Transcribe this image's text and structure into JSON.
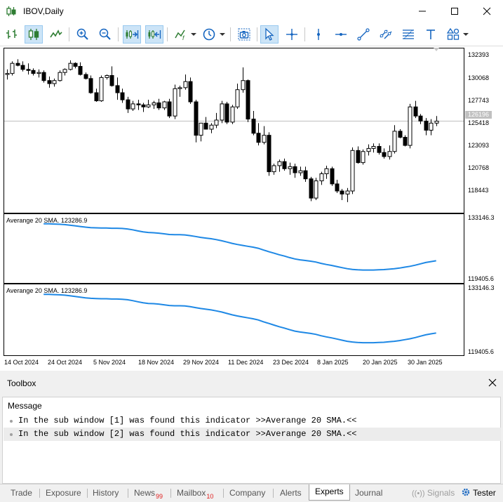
{
  "window": {
    "title": "IBOV,Daily",
    "controls": {
      "minimize": "minimize",
      "maximize": "maximize",
      "close": "close"
    }
  },
  "toolbar": {
    "items": [
      "bar-chart-icon",
      "candlestick-icon",
      "line-chart-icon",
      "zoom-in-icon",
      "zoom-out-icon",
      "autoscroll-icon",
      "chart-shift-icon",
      "indicators-icon",
      "periods-icon",
      "screenshot-icon",
      "cursor-icon",
      "crosshair-icon",
      "vertical-line-icon",
      "horizontal-line-icon",
      "trendline-icon",
      "channel-icon",
      "fibonacci-icon",
      "text-icon",
      "shapes-icon"
    ]
  },
  "chart": {
    "symbol": "IBOV",
    "timeframe": "Daily",
    "bid_price": "126196",
    "price_axis": [
      "132393",
      "130068",
      "127743",
      "125418",
      "123093",
      "120768",
      "118443"
    ],
    "date_axis": [
      "14 Oct 2024",
      "24 Oct 2024",
      "5 Nov 2024",
      "18 Nov 2024",
      "29 Nov 2024",
      "11 Dec 2024",
      "23 Dec 2024",
      "8 Jan 2025",
      "20 Jan 2025",
      "30 Jan 2025"
    ],
    "sub1": {
      "label": "Averange 20 SMA. 123286.9",
      "max": "133146.3",
      "min": "119405.6"
    },
    "sub2": {
      "label": "Averange 20 SMA. 123286.9",
      "max": "133146.3",
      "min": "119405.6"
    },
    "colors": {
      "sma_line": "#1e88e5",
      "bull": "#ffffff",
      "bear": "#000000"
    }
  },
  "chart_data": {
    "type": "candlestick",
    "ylim": [
      117500,
      133300
    ],
    "candles": [
      [
        130800,
        131300,
        130300,
        130900
      ],
      [
        130900,
        132100,
        130700,
        131900
      ],
      [
        131900,
        132300,
        131600,
        131700
      ],
      [
        131700,
        132100,
        131100,
        131300
      ],
      [
        131300,
        131900,
        130800,
        131200
      ],
      [
        131200,
        131400,
        130700,
        130900
      ],
      [
        130900,
        131300,
        130500,
        131000
      ],
      [
        131000,
        131200,
        130000,
        130200
      ],
      [
        130200,
        130600,
        129500,
        129900
      ],
      [
        129900,
        130400,
        129600,
        130200
      ],
      [
        130200,
        131200,
        130100,
        131000
      ],
      [
        131000,
        131400,
        130700,
        131300
      ],
      [
        131300,
        132200,
        131200,
        131900
      ],
      [
        131900,
        132000,
        131400,
        131600
      ],
      [
        131600,
        132000,
        130700,
        130800
      ],
      [
        130800,
        131000,
        130300,
        130400
      ],
      [
        130400,
        130700,
        128900,
        129000
      ],
      [
        129000,
        129400,
        128100,
        128200
      ],
      [
        128200,
        130700,
        128100,
        130500
      ],
      [
        130500,
        130800,
        130300,
        130700
      ],
      [
        130700,
        131600,
        129600,
        129700
      ],
      [
        129700,
        130500,
        128300,
        129000
      ],
      [
        129000,
        129400,
        128000,
        128300
      ],
      [
        128300,
        128600,
        127000,
        127400
      ],
      [
        127400,
        128200,
        127200,
        127900
      ],
      [
        127900,
        128300,
        127300,
        127800
      ],
      [
        127800,
        128000,
        127100,
        127600
      ],
      [
        127600,
        128300,
        127500,
        127800
      ],
      [
        127800,
        128200,
        127400,
        128000
      ],
      [
        128000,
        128400,
        127300,
        127500
      ],
      [
        127500,
        128200,
        127300,
        128100
      ],
      [
        128100,
        128400,
        126500,
        126700
      ],
      [
        126700,
        129800,
        126400,
        129400
      ],
      [
        129400,
        129700,
        128600,
        129500
      ],
      [
        129500,
        130800,
        129300,
        130100
      ],
      [
        130100,
        130500,
        127900,
        128100
      ],
      [
        128100,
        128300,
        124100,
        124800
      ],
      [
        124800,
        125600,
        124200,
        126000
      ],
      [
        126000,
        126600,
        125400,
        125400
      ],
      [
        125400,
        126000,
        125000,
        125800
      ],
      [
        125800,
        127000,
        125500,
        126300
      ],
      [
        126300,
        128200,
        126000,
        127900
      ],
      [
        127900,
        128100,
        125900,
        126100
      ],
      [
        126100,
        127800,
        125900,
        127600
      ],
      [
        127600,
        129900,
        127400,
        129300
      ],
      [
        129300,
        131500,
        129000,
        130200
      ],
      [
        130200,
        130300,
        126100,
        126400
      ],
      [
        126400,
        127200,
        124800,
        125000
      ],
      [
        125000,
        126000,
        123800,
        124100
      ],
      [
        124100,
        125700,
        123900,
        124800
      ],
      [
        124800,
        125100,
        120800,
        121200
      ],
      [
        121200,
        122000,
        120900,
        121800
      ],
      [
        121800,
        122400,
        121200,
        122200
      ],
      [
        122200,
        122500,
        121300,
        121500
      ],
      [
        121500,
        122100,
        120900,
        121700
      ],
      [
        121700,
        122000,
        120600,
        121100
      ],
      [
        121100,
        121700,
        120800,
        121300
      ],
      [
        121300,
        121700,
        120200,
        120500
      ],
      [
        120500,
        120700,
        118300,
        118600
      ],
      [
        118600,
        120600,
        118400,
        120300
      ],
      [
        120300,
        121200,
        119900,
        121000
      ],
      [
        121000,
        121800,
        120500,
        121500
      ],
      [
        121500,
        121700,
        119800,
        120000
      ],
      [
        120000,
        120400,
        119100,
        119300
      ],
      [
        119300,
        119500,
        118400,
        119000
      ],
      [
        119000,
        119600,
        118200,
        119300
      ],
      [
        119300,
        123600,
        119000,
        123300
      ],
      [
        123300,
        123700,
        122000,
        122100
      ],
      [
        122100,
        123400,
        121900,
        123200
      ],
      [
        123200,
        123900,
        122800,
        123500
      ],
      [
        123500,
        124000,
        123100,
        123700
      ],
      [
        123700,
        124000,
        122900,
        123100
      ],
      [
        123100,
        123500,
        122500,
        122700
      ],
      [
        122700,
        123800,
        122400,
        123200
      ],
      [
        123200,
        125800,
        123000,
        125200
      ],
      [
        125200,
        125400,
        124500,
        124600
      ],
      [
        124600,
        124800,
        123700,
        123800
      ],
      [
        123800,
        127900,
        123500,
        127600
      ],
      [
        127600,
        128200,
        126500,
        126700
      ],
      [
        126700,
        126900,
        125900,
        126200
      ],
      [
        126200,
        126500,
        124800,
        125300
      ],
      [
        125300,
        126400,
        124800,
        126000
      ],
      [
        126000,
        126700,
        125700,
        126196
      ]
    ],
    "sma": [
      131600,
      131600,
      131550,
      131500,
      131420,
      131300,
      131150,
      131000,
      130850,
      130750,
      130700,
      130650,
      130650,
      130600,
      130600,
      130550,
      130450,
      130250,
      130000,
      129800,
      129650,
      129600,
      129500,
      129350,
      129200,
      129150,
      129150,
      129100,
      128950,
      128750,
      128550,
      128400,
      128250,
      128050,
      127800,
      127500,
      127200,
      126950,
      126750,
      126550,
      126350,
      126100,
      125700,
      125350,
      125000,
      124650,
      124350,
      124000,
      123700,
      123500,
      123350,
      123200,
      123000,
      122700,
      122450,
      122250,
      122000,
      121750,
      121500,
      121350,
      121250,
      121200,
      121200,
      121200,
      121250,
      121300,
      121400,
      121500,
      121650,
      121850,
      122050,
      122300,
      122600,
      122900,
      123100,
      123286.9
    ],
    "sub_ylim": [
      119405.6,
      133146.3
    ]
  },
  "toolbox": {
    "title": "Toolbox",
    "column_header": "Message",
    "messages": [
      "In the sub window [1] was found this indicator >>Averange 20 SMA.<<",
      "In the sub window [2] was found this indicator >>Averange 20 SMA.<<"
    ]
  },
  "tabs": [
    {
      "label": "Trade",
      "badge": ""
    },
    {
      "label": "Exposure",
      "badge": ""
    },
    {
      "label": "History",
      "badge": ""
    },
    {
      "label": "News",
      "badge": "99"
    },
    {
      "label": "Mailbox",
      "badge": "10"
    },
    {
      "label": "Company",
      "badge": ""
    },
    {
      "label": "Alerts",
      "badge": ""
    },
    {
      "label": "Experts",
      "badge": ""
    },
    {
      "label": "Journal",
      "badge": ""
    }
  ],
  "active_tab": "Experts",
  "right_tabs": {
    "signals": "Signals",
    "tester": "Tester"
  }
}
